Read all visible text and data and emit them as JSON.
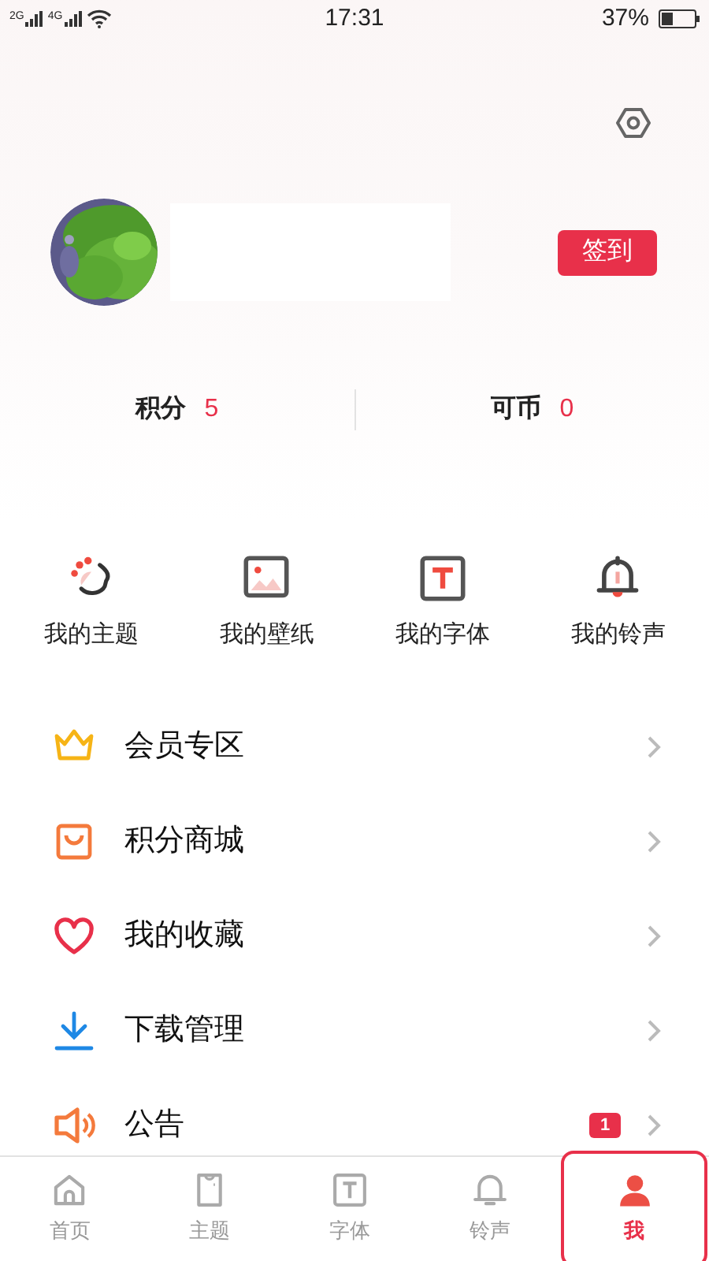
{
  "status_bar": {
    "signal_1": "2G",
    "signal_2": "4G",
    "time": "17:31",
    "battery": "37%"
  },
  "profile": {
    "sign_in_button": "签到"
  },
  "stats": [
    {
      "label": "积分",
      "value": "5"
    },
    {
      "label": "可币",
      "value": "0"
    }
  ],
  "shortcuts": [
    {
      "kind": "theme",
      "label": "我的主题"
    },
    {
      "kind": "wallpaper",
      "label": "我的壁纸"
    },
    {
      "kind": "font",
      "label": "我的字体"
    },
    {
      "kind": "ringtone",
      "label": "我的铃声"
    }
  ],
  "menu": [
    {
      "kind": "crown",
      "label": "会员专区"
    },
    {
      "kind": "bag",
      "label": "积分商城"
    },
    {
      "kind": "heart",
      "label": "我的收藏"
    },
    {
      "kind": "download",
      "label": "下载管理"
    },
    {
      "kind": "speaker",
      "label": "公告",
      "badge": "1"
    }
  ],
  "tab_bar": [
    {
      "kind": "home",
      "label": "首页",
      "selected": false
    },
    {
      "kind": "shirt",
      "label": "主题",
      "selected": false
    },
    {
      "kind": "font",
      "label": "字体",
      "selected": false
    },
    {
      "kind": "bell",
      "label": "铃声",
      "selected": false
    },
    {
      "kind": "person",
      "label": "我",
      "selected": true
    }
  ]
}
